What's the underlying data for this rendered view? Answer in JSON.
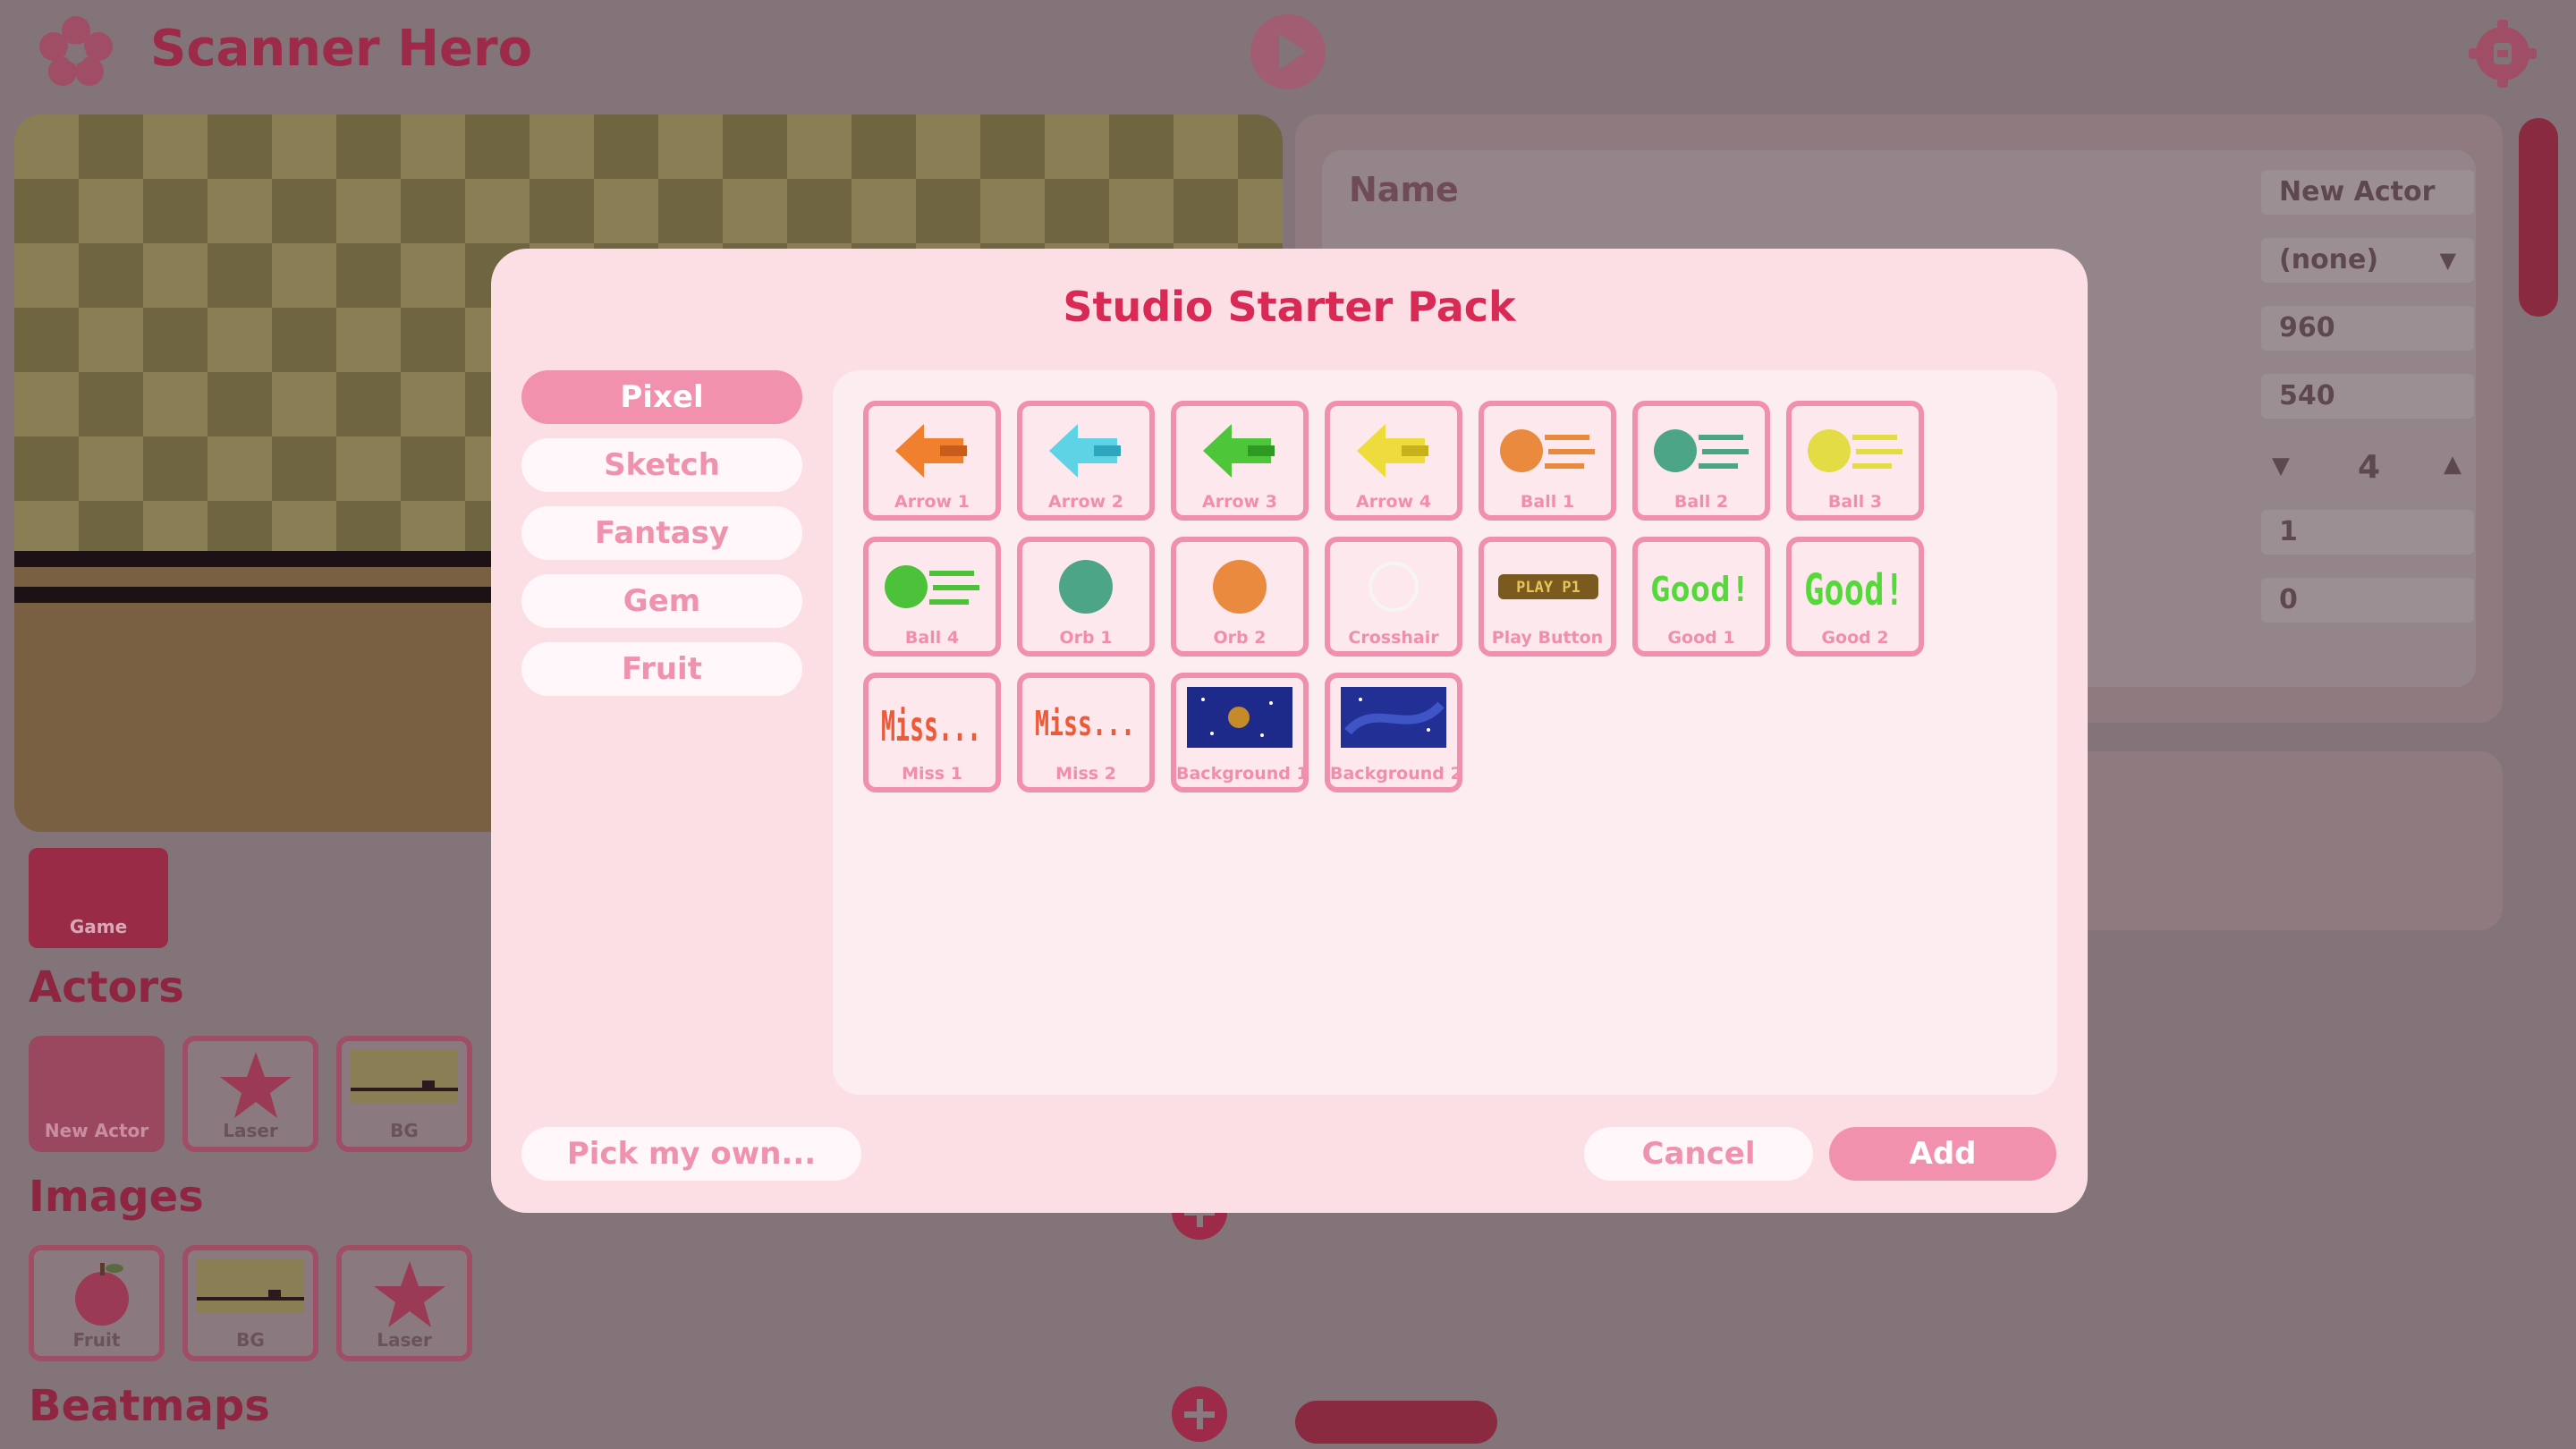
{
  "app": {
    "title": "Scanner Hero"
  },
  "inspector": {
    "name_label": "Name",
    "name_value": "New Actor",
    "dropdown_value": "(none)",
    "field_x": "960",
    "field_y": "540",
    "stepper_value": "4",
    "field_scale": "1",
    "field_rotation": "0"
  },
  "left": {
    "game_label": "Game",
    "actors_heading": "Actors",
    "actors": [
      "New Actor",
      "Laser",
      "BG"
    ],
    "images_heading": "Images",
    "images": [
      "Fruit",
      "BG",
      "Laser"
    ],
    "beatmaps_heading": "Beatmaps"
  },
  "modal": {
    "title": "Studio Starter Pack",
    "categories": [
      "Pixel",
      "Sketch",
      "Fantasy",
      "Gem",
      "Fruit"
    ],
    "selected_category": "Pixel",
    "items": [
      {
        "label": "Arrow 1",
        "icon": "orange-arrow-icon"
      },
      {
        "label": "Arrow 2",
        "icon": "cyan-arrow-icon"
      },
      {
        "label": "Arrow 3",
        "icon": "green-arrow-icon"
      },
      {
        "label": "Arrow 4",
        "icon": "yellow-arrow-icon"
      },
      {
        "label": "Ball 1",
        "icon": "orange-ball-icon"
      },
      {
        "label": "Ball 2",
        "icon": "teal-ball-icon"
      },
      {
        "label": "Ball 3",
        "icon": "yellow-ball-icon"
      },
      {
        "label": "Ball 4",
        "icon": "green-ball-icon"
      },
      {
        "label": "Orb 1",
        "icon": "teal-orb-icon"
      },
      {
        "label": "Orb 2",
        "icon": "orange-orb-icon"
      },
      {
        "label": "Crosshair",
        "icon": "crosshair-icon"
      },
      {
        "label": "Play Button",
        "icon": "play-button-icon"
      },
      {
        "label": "Good 1",
        "icon": "good-text-icon"
      },
      {
        "label": "Good 2",
        "icon": "good-text-icon"
      },
      {
        "label": "Miss 1",
        "icon": "miss-text-icon"
      },
      {
        "label": "Miss 2",
        "icon": "miss-text-icon"
      },
      {
        "label": "Background 1",
        "icon": "space-background-icon"
      },
      {
        "label": "Background 2",
        "icon": "space-background-icon"
      }
    ],
    "play_button_art_text": "PLAY P1",
    "good_art_text": [
      "Good!",
      "Good!"
    ],
    "miss_art_text": [
      "Miss...",
      "Miss..."
    ],
    "pick_own_label": "Pick my own...",
    "cancel_label": "Cancel",
    "add_label": "Add"
  },
  "colors": {
    "accent": "#d82a55",
    "pink": "#f291ad",
    "modal_bg": "#fbdfe5"
  }
}
